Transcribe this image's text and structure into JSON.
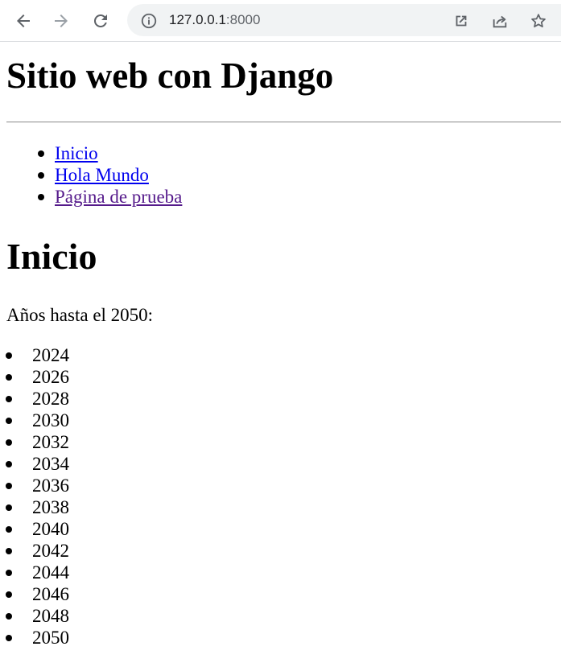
{
  "browser": {
    "url_host": "127.0.0.1",
    "url_port": ":8000",
    "icons": {
      "back": "arrow-left-icon",
      "forward": "arrow-right-icon",
      "reload": "reload-icon",
      "site_info": "info-circle-icon",
      "open_in_app": "open-external-icon",
      "share": "share-icon",
      "bookmark": "star-icon"
    },
    "colors": {
      "toolbar_icon": "#5f6368",
      "forward_disabled": "#9aa0a6",
      "omnibox_bg": "#f1f3f4"
    }
  },
  "page": {
    "site_title": "Sitio web con Django",
    "nav": [
      {
        "label": "Inicio",
        "visited": false
      },
      {
        "label": "Hola Mundo",
        "visited": false
      },
      {
        "label": "Página de prueba",
        "visited": true
      }
    ],
    "heading": "Inicio",
    "intro": "Años hasta el 2050:",
    "years": [
      "2024",
      "2026",
      "2028",
      "2030",
      "2032",
      "2034",
      "2036",
      "2038",
      "2040",
      "2042",
      "2044",
      "2046",
      "2048",
      "2050"
    ],
    "colors": {
      "link": "#0000ee",
      "visited_link": "#551a8b"
    }
  }
}
